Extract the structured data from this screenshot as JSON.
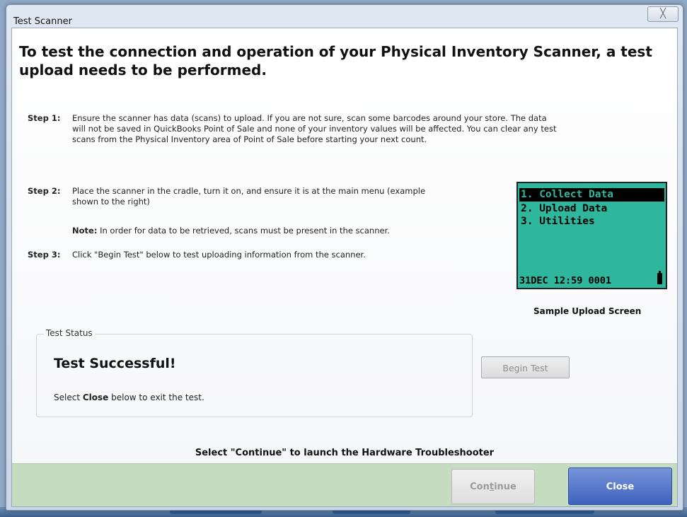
{
  "window": {
    "title": "Test Scanner",
    "close_glyph": "╳"
  },
  "heading": "To test the connection and operation of your Physical Inventory Scanner, a test upload  needs to be performed.",
  "steps": [
    {
      "label": "Step 1:",
      "text_lines": [
        "Ensure the scanner has data (scans) to upload. If you are not sure, scan some barcodes around your store.  The data",
        "will not be saved in QuickBooks Point of Sale and none of your inventory values will be affected.  You can clear any test",
        "scans from the Physical Inventory area of Point of Sale before starting your next count."
      ]
    },
    {
      "label": "Step 2:",
      "text_lines": [
        "Place the scanner in the cradle, turn it on, and ensure it is at the main menu (example",
        "shown to the right)"
      ]
    },
    {
      "label": "Step 3:",
      "text_lines": [
        "Click \"Begin Test\" below to test uploading information from the scanner."
      ]
    }
  ],
  "note": {
    "label": "Note:",
    "text": " In order for data to be retrieved, scans must be present in the scanner."
  },
  "scanner_screen": {
    "menu": [
      "1. Collect Data",
      "2. Upload Data",
      "3. Utilities"
    ],
    "footer": "31DEC 12:59 0001",
    "caption": "Sample Upload Screen"
  },
  "status": {
    "legend": "Test Status",
    "title": "Test Successful!",
    "msg_prefix": "Select ",
    "msg_bold": "Close",
    "msg_suffix": " below to exit the test."
  },
  "begin_button": "Begin Test",
  "continue_hint": "Select \"Continue\" to launch the Hardware Troubleshooter",
  "footer": {
    "continue_prefix": "Con",
    "continue_underlined": "t",
    "continue_suffix": "inue",
    "close_label": "Close"
  },
  "colors": {
    "lcd": "#2fb79e",
    "footer": "#c5dcc0",
    "primary_button": "#4a6cc7"
  }
}
